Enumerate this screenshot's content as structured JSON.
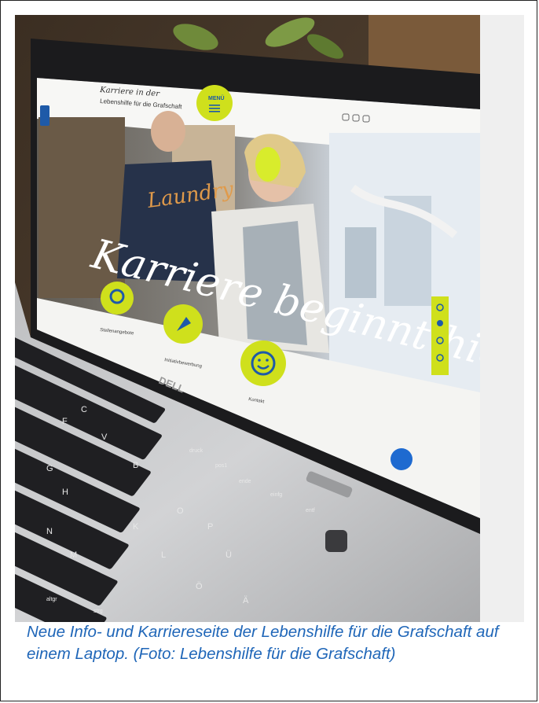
{
  "photo": {
    "screen": {
      "logo_line1": "Karriere in der",
      "logo_line2": "Lebenshilfe für die Grafschaft",
      "menu_label": "MENÜ",
      "hero_text": "Karriere beginnt hier.",
      "shirt_text": "Laundry",
      "circle_labels": [
        "Stellenangebote",
        "Initiativbewerbung",
        "Kontakt"
      ]
    },
    "laptop_brand": "DELL",
    "keys": [
      "Ü",
      "Ö",
      "Ä",
      "P",
      "O",
      "L",
      "K",
      "M",
      "N",
      "H",
      "G",
      "B",
      "V",
      "F",
      "C",
      "einfg",
      "entf",
      "ende",
      "pos1",
      "druck",
      "altgr",
      "strg"
    ]
  },
  "caption": "Neue Info- und Karriereseite der Lebenshilfe für die Grafschaft auf einem Laptop. (Foto: Lebenshilfe für die Grafschaft)"
}
